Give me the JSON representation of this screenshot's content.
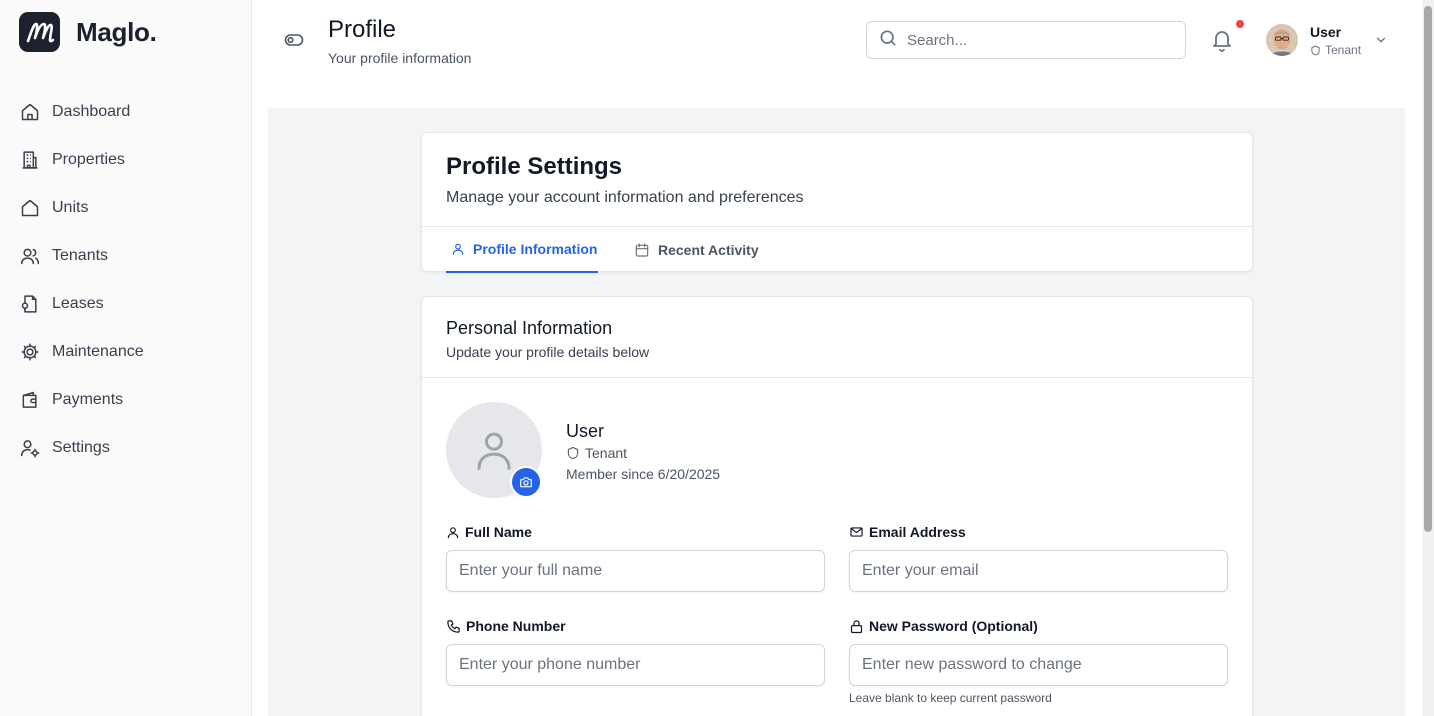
{
  "brand": {
    "name": "Maglo."
  },
  "sidebar": {
    "items": [
      {
        "label": "Dashboard",
        "icon": "home-icon"
      },
      {
        "label": "Properties",
        "icon": "building-icon"
      },
      {
        "label": "Units",
        "icon": "home-icon"
      },
      {
        "label": "Tenants",
        "icon": "users-icon"
      },
      {
        "label": "Leases",
        "icon": "file-icon"
      },
      {
        "label": "Maintenance",
        "icon": "gear-icon"
      },
      {
        "label": "Payments",
        "icon": "wallet-icon"
      },
      {
        "label": "Settings",
        "icon": "user-settings-icon"
      }
    ]
  },
  "header": {
    "title": "Profile",
    "subtitle": "Your profile information",
    "search_placeholder": "Search...",
    "user": {
      "name": "User",
      "role": "Tenant"
    }
  },
  "settings_card": {
    "title": "Profile Settings",
    "subtitle": "Manage your account information and preferences",
    "tabs": [
      {
        "label": "Profile Information",
        "active": true
      },
      {
        "label": "Recent Activity",
        "active": false
      }
    ]
  },
  "personal_info": {
    "title": "Personal Information",
    "subtitle": "Update your profile details below",
    "profile": {
      "name": "User",
      "role": "Tenant",
      "member_since": "Member since 6/20/2025"
    },
    "fields": {
      "full_name": {
        "label": "Full Name",
        "placeholder": "Enter your full name",
        "value": ""
      },
      "email": {
        "label": "Email Address",
        "placeholder": "Enter your email",
        "value": ""
      },
      "phone": {
        "label": "Phone Number",
        "placeholder": "Enter your phone number",
        "value": ""
      },
      "password": {
        "label": "New Password (Optional)",
        "placeholder": "Enter new password to change",
        "value": "",
        "hint": "Leave blank to keep current password"
      }
    }
  },
  "colors": {
    "accent": "#2563eb",
    "brand_dark": "#1b212d",
    "notification": "#ef4444"
  }
}
